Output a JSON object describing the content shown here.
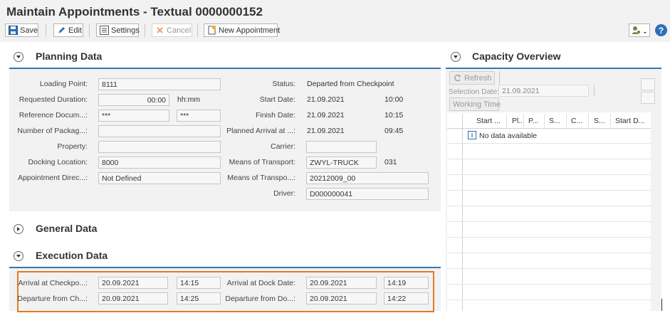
{
  "window": {
    "title": "Maintain Appointments - Textual 0000000152"
  },
  "toolbar": {
    "save": "Save",
    "edit": "Edit",
    "settings": "Settings",
    "cancel": "Cancel",
    "new_appointment": "New Appointment"
  },
  "planning": {
    "title": "Planning Data",
    "left": [
      {
        "label": "Loading Point:",
        "value": "8111"
      },
      {
        "label": "Requested Duration:",
        "value": "00:00",
        "unit": "hh:mm"
      },
      {
        "label": "Reference Docum...:",
        "value": "***",
        "value2": "***"
      },
      {
        "label": "Number of Packag...:",
        "value": ""
      },
      {
        "label": "Property:",
        "value": ""
      },
      {
        "label": "Docking Location:",
        "value": "8000"
      },
      {
        "label": "Appointment Direc...:",
        "value": "Not Defined"
      }
    ],
    "right": [
      {
        "label": "Status:",
        "value": "Departed from Checkpoint",
        "extra": ""
      },
      {
        "label": "Start Date:",
        "value": "21.09.2021",
        "extra": "10:00"
      },
      {
        "label": "Finish Date:",
        "value": "21.09.2021",
        "extra": "10:15"
      },
      {
        "label": "Planned Arrival at ...:",
        "value": "21.09.2021",
        "extra": "09:45"
      },
      {
        "label": "Carrier:",
        "value": "",
        "extra": ""
      },
      {
        "label": "Means of Transport:",
        "value": "ZWYL-TRUCK",
        "extra": "031"
      },
      {
        "label": "Means of Transpo...:",
        "value": "20212009_00",
        "extra": ""
      },
      {
        "label": "Driver:",
        "value": "D000000041",
        "extra": ""
      }
    ]
  },
  "general": {
    "title": "General Data"
  },
  "execution": {
    "title": "Execution Data",
    "rows": [
      {
        "label": "Arrival at Checkpo...:",
        "date": "20.09.2021",
        "time": "14:15",
        "label2": "Arrival at Dock Date:",
        "date2": "20.09.2021",
        "time2": "14:19"
      },
      {
        "label": "Departure from Ch...:",
        "date": "20.09.2021",
        "time": "14:25",
        "label2": "Departure from Do...:",
        "date2": "20.09.2021",
        "time2": "14:22"
      }
    ]
  },
  "capacity": {
    "title": "Capacity Overview",
    "refresh": "Refresh",
    "selection_label": "Selection Date:",
    "selection_value": "21.09.2021",
    "working_time": "Working Time",
    "columns": [
      "Start ...",
      "Pl...",
      "P...",
      "S...",
      "C...",
      "S...",
      "Start D..."
    ],
    "empty": "No data available"
  },
  "colors": {
    "accent": "#3a74b0",
    "highlight": "#e07b24"
  }
}
